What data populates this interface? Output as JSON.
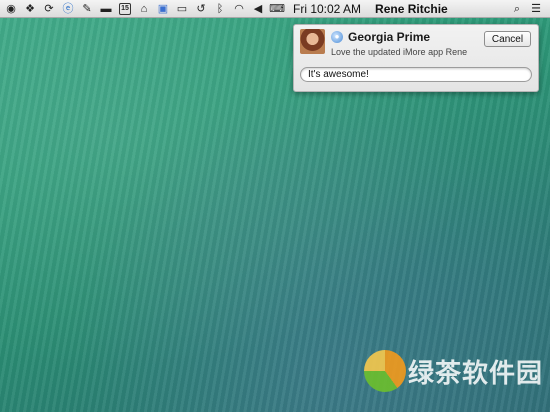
{
  "menubar": {
    "icons": [
      "app-icon-circle",
      "dropbox-icon",
      "sync-icon",
      "ie-icon",
      "wrench-icon",
      "chat-icon",
      "calendar-icon",
      "home-icon",
      "shield-icon",
      "airplay-icon",
      "time-machine-icon",
      "bluetooth-icon",
      "wifi-icon",
      "volume-icon",
      "keyboard-icon"
    ],
    "calendar_day": "15",
    "clock": "Fri 10:02 AM",
    "user": "Rene Ritchie"
  },
  "notification": {
    "sender": "Georgia Prime",
    "message": "Love the updated iMore app Rene",
    "cancel_label": "Cancel",
    "reply_value": "It's awesome!"
  },
  "watermark": {
    "text": "绿茶软件园"
  }
}
